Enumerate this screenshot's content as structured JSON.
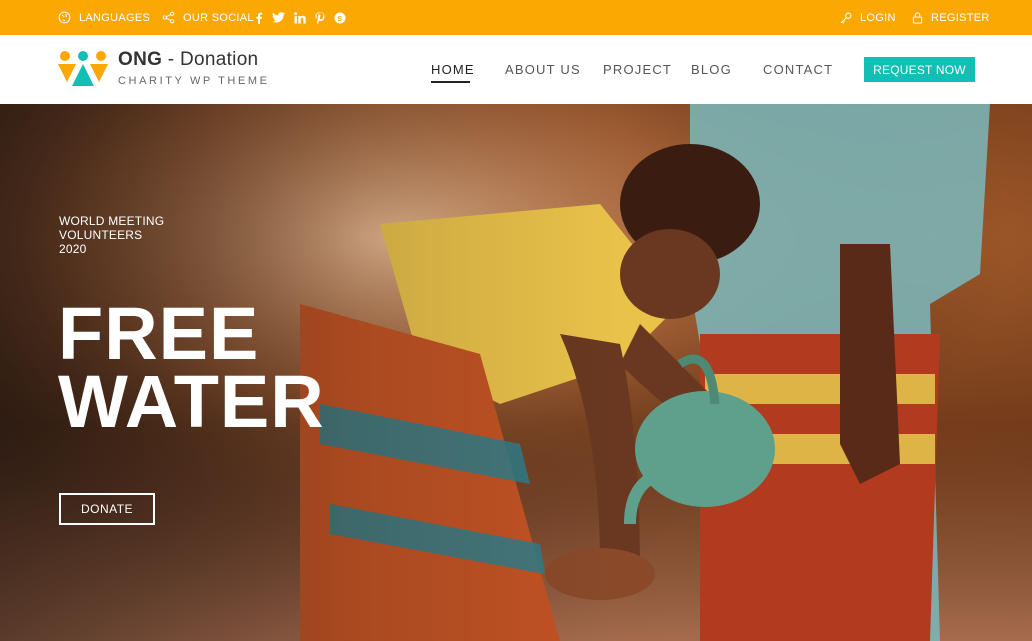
{
  "topbar": {
    "languages_label": "LANGUAGES",
    "social_label": "OUR SOCIAL",
    "social_icons": [
      "facebook-icon",
      "twitter-icon",
      "linkedin-icon",
      "pinterest-icon",
      "skype-icon"
    ],
    "social_glyphs": [
      "f",
      "t",
      "in",
      "p",
      "s"
    ],
    "login_label": "LOGIN",
    "register_label": "REGISTER",
    "background": "#fba802"
  },
  "brand": {
    "name_bold": "ONG",
    "name_rest": " - Donation",
    "tagline": "CHARITY WP THEME",
    "logo_colors": [
      "#fba802",
      "#12bfb4"
    ]
  },
  "nav": {
    "items": [
      {
        "label": "HOME",
        "active": true
      },
      {
        "label": "ABOUT US",
        "active": false
      },
      {
        "label": "PROJECT",
        "active": false
      },
      {
        "label": "BLOG",
        "active": false
      },
      {
        "label": "CONTACT",
        "active": false
      }
    ],
    "cta_label": "REQUEST NOW",
    "cta_color": "#12bfb4"
  },
  "hero": {
    "kicker_lines": [
      "WORLD MEETING",
      "VOLUNTEERS",
      "2020"
    ],
    "headline_lines": [
      "FREE",
      "WATER"
    ],
    "donate_label": "DONATE"
  }
}
